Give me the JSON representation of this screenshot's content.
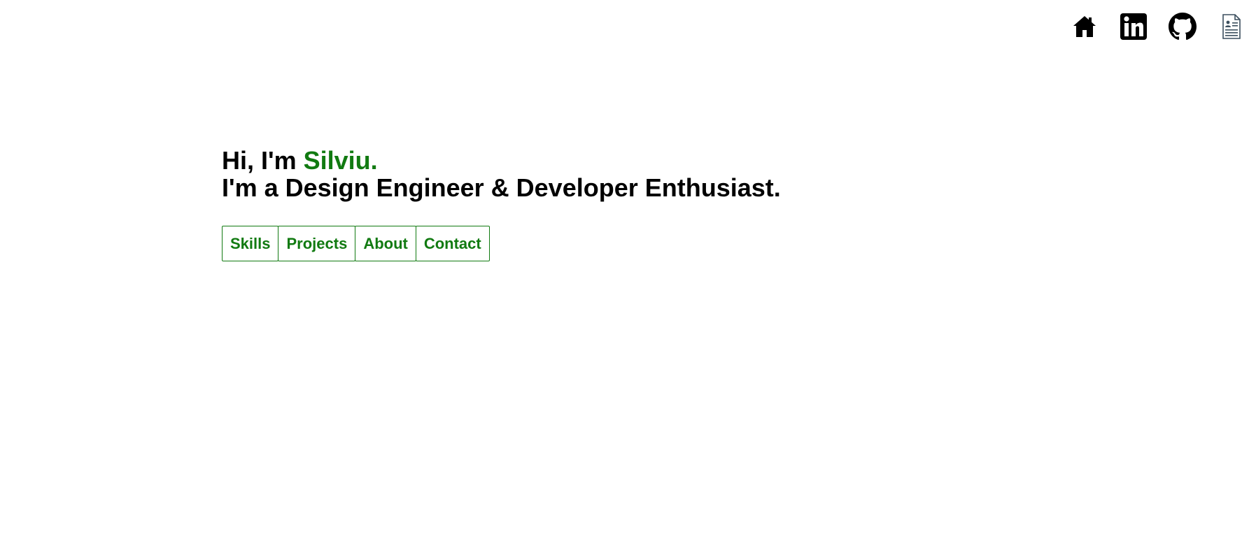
{
  "nav": {
    "icons": [
      {
        "name": "home-icon",
        "label": "Home"
      },
      {
        "name": "linkedin-icon",
        "label": "LinkedIn"
      },
      {
        "name": "github-icon",
        "label": "GitHub"
      },
      {
        "name": "resume-icon",
        "label": "Resume"
      }
    ]
  },
  "hero": {
    "greeting_prefix": "Hi, I'm ",
    "name": "Silviu.",
    "tagline": "I'm a Design Engineer & Developer Enthusiast."
  },
  "buttons": {
    "skills": "Skills",
    "projects": "Projects",
    "about": "About",
    "contact": "Contact"
  },
  "colors": {
    "accent": "#117a11",
    "text": "#000000",
    "background": "#ffffff"
  }
}
